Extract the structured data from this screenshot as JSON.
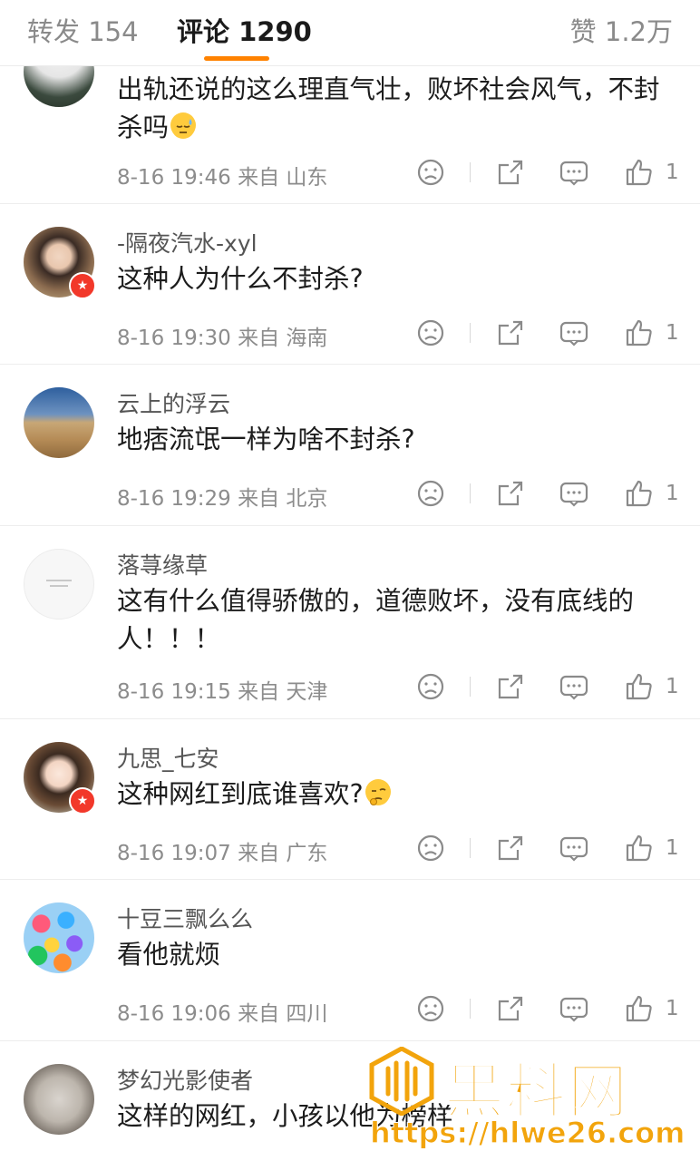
{
  "tabs": {
    "repost": "转发 154",
    "comments": "评论 1290",
    "likes": "赞 1.2万"
  },
  "comments": [
    {
      "username": "",
      "text": "出轨还说的这么理直气壮，败坏社会风气，不封杀吗",
      "emoji": "sweat-face",
      "meta": "8-16 19:46 来自 山东",
      "likes": "1"
    },
    {
      "username": "-隔夜汽水-xyl",
      "text": "这种人为什么不封杀?",
      "meta": "8-16 19:30 来自 海南",
      "likes": "1"
    },
    {
      "username": "云上的浮云",
      "text": "地痞流氓一样为啥不封杀?",
      "meta": "8-16 19:29 来自 北京",
      "likes": "1"
    },
    {
      "username": "落荨缘草",
      "text": "这有什么值得骄傲的，道德败坏，没有底线的人！！！",
      "meta": "8-16 19:15 来自 天津",
      "likes": "1"
    },
    {
      "username": "九思_七安",
      "text": "这种网红到底谁喜欢?",
      "emoji": "thinking-face",
      "meta": "8-16 19:07 来自 广东",
      "likes": "1"
    },
    {
      "username": "十豆三飘么么",
      "text": "看他就烦",
      "meta": "8-16 19:06 来自 四川",
      "likes": "1"
    },
    {
      "username": "梦幻光影使者",
      "text": "这样的网红，小孩以他为榜样",
      "meta": "",
      "likes": ""
    }
  ],
  "icons": {
    "dislike": "frown-face-icon",
    "repost": "share-icon",
    "reply": "comment-bubble-icon",
    "like": "thumb-up-icon"
  },
  "watermark": {
    "title": "黑料网",
    "url": "https://hlwe26.com"
  },
  "colors": {
    "accent": "#ff8200",
    "badge": "#f2382a",
    "watermark": "#f2a40c"
  }
}
